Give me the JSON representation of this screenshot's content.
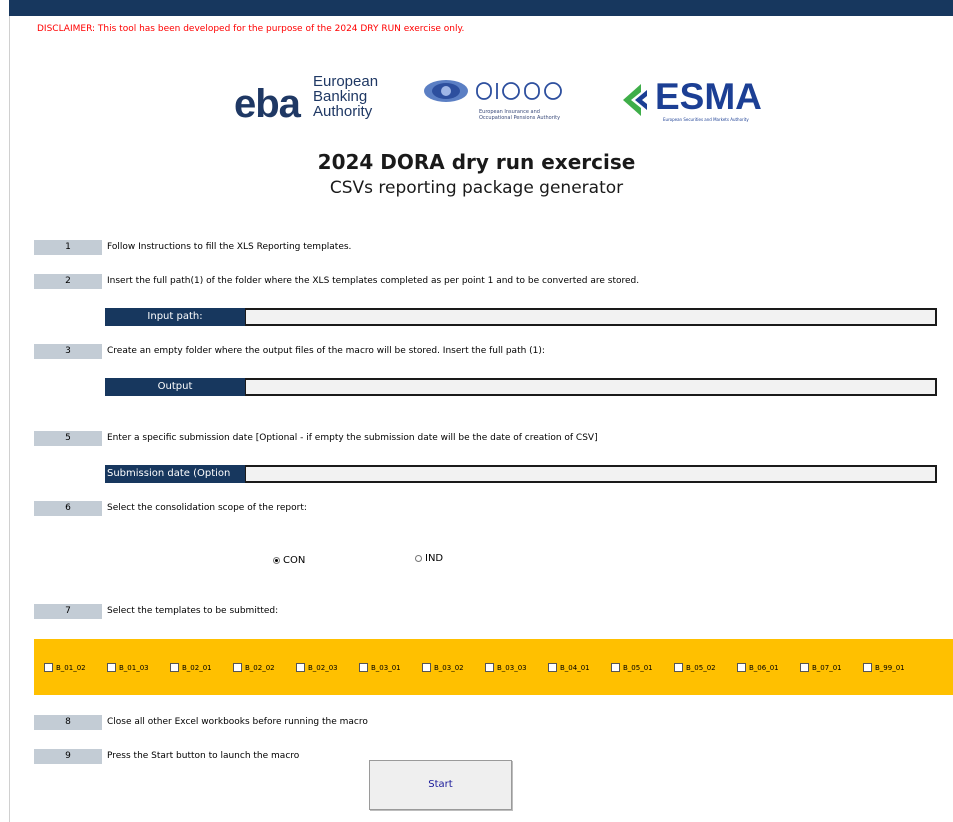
{
  "disclaimer": "DISCLAIMER: This tool has been developed for the purpose of the 2024 DRY RUN exercise only.",
  "logos": {
    "eba": {
      "word": "eba",
      "line1": "European",
      "line2": "Banking",
      "line3": "Authority"
    },
    "eiopa": {
      "word": "eiopa",
      "sub1": "European Insurance and",
      "sub2": "Occupational Pensions Authority"
    },
    "esma": {
      "word": "ESMA",
      "sub": "European Securities and Markets Authority"
    }
  },
  "title": "2024 DORA dry run exercise",
  "subtitle": "CSVs reporting package generator",
  "steps": [
    {
      "num": "1",
      "text": "Follow Instructions to fill the XLS Reporting templates."
    },
    {
      "num": "2",
      "text": "Insert the full path(1) of the folder where the XLS templates completed as per point 1 and to be converted are stored."
    },
    {
      "num": "3",
      "text": "Create an empty folder where the output files of the macro will be stored. Insert the full path (1):"
    },
    {
      "num": "5",
      "text": "Enter a specific submission date  [Optional - if empty the submission date will be the date of creation of CSV]"
    },
    {
      "num": "6",
      "text": "Select the consolidation scope of the report:"
    },
    {
      "num": "7",
      "text": "Select the templates to be submitted:"
    },
    {
      "num": "8",
      "text": "Close all other Excel workbooks before running the macro"
    },
    {
      "num": "9",
      "text": "Press the Start button to launch the macro"
    }
  ],
  "fields": {
    "input_path": {
      "label": "Input path:",
      "value": ""
    },
    "output": {
      "label": "Output",
      "value": ""
    },
    "submission_date": {
      "label": "Submission date (Option",
      "value": ""
    }
  },
  "scope": {
    "options": [
      {
        "label": "CON",
        "selected": true
      },
      {
        "label": "IND",
        "selected": false
      }
    ]
  },
  "templates": [
    {
      "label": "B_01_02",
      "checked": false
    },
    {
      "label": "B_01_03",
      "checked": false
    },
    {
      "label": "B_02_01",
      "checked": false
    },
    {
      "label": "B_02_02",
      "checked": false
    },
    {
      "label": "B_02_03",
      "checked": false
    },
    {
      "label": "B_03_01",
      "checked": false
    },
    {
      "label": "B_03_02",
      "checked": false
    },
    {
      "label": "B_03_03",
      "checked": false
    },
    {
      "label": "B_04_01",
      "checked": false
    },
    {
      "label": "B_05_01",
      "checked": false
    },
    {
      "label": "B_05_02",
      "checked": false
    },
    {
      "label": "B_06_01",
      "checked": false
    },
    {
      "label": "B_07_01",
      "checked": false
    },
    {
      "label": "B_99_01",
      "checked": false
    }
  ],
  "start_button": "Start",
  "colors": {
    "header_navy": "#17375e",
    "step_gray": "#c3ccd5",
    "template_band": "#ffc000",
    "disclaimer_red": "#ff0000"
  }
}
